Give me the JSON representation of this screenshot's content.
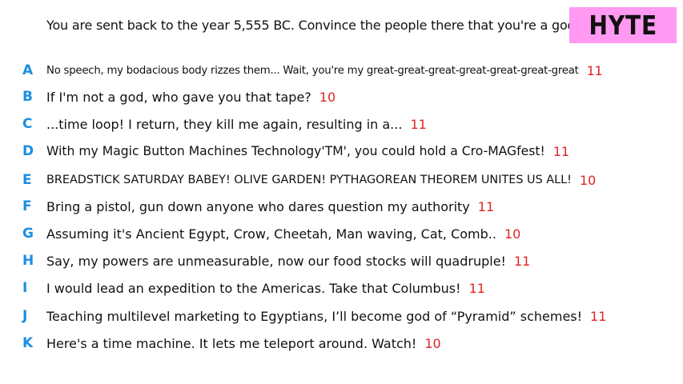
{
  "prompt": "You are sent back to the year 5,555 BC. Convince the people there that you're a god.",
  "brand": "HYTE",
  "colors": {
    "letter": "#1a8fe0",
    "score": "#e32222",
    "badge_bg": "#ff99f2"
  },
  "answers": [
    {
      "letter": "A",
      "text": "No speech, my bodacious body rizzes them... Wait, you're my great-great-great-great-great-great-great",
      "score": "11"
    },
    {
      "letter": "B",
      "text": "If I'm not a god, who gave you that tape?",
      "score": "10"
    },
    {
      "letter": "C",
      "text": "...time loop! I return, they kill me again, resulting in a...",
      "score": "11"
    },
    {
      "letter": "D",
      "text": "With my Magic Button Machines Technology'TM', you could hold a Cro-MAGfest!",
      "score": "11"
    },
    {
      "letter": "E",
      "text": "BREADSTICK SATURDAY BABEY! OLIVE GARDEN! PYTHAGOREAN THEOREM UNITES US ALL!",
      "score": "10"
    },
    {
      "letter": "F",
      "text": "Bring a pistol, gun down anyone who dares question my authority",
      "score": "11"
    },
    {
      "letter": "G",
      "text": "Assuming it's Ancient Egypt, Crow, Cheetah, Man waving, Cat, Comb..",
      "score": "10"
    },
    {
      "letter": "H",
      "text": "Say, my powers are unmeasurable, now our food stocks will quadruple!",
      "score": "11"
    },
    {
      "letter": "I",
      "text": "I would lead an expedition to the Americas. Take that Columbus!",
      "score": "11"
    },
    {
      "letter": "J",
      "text": "Teaching multilevel marketing to Egyptians, I’ll become god of “Pyramid” schemes!",
      "score": "11"
    },
    {
      "letter": "K",
      "text": "Here's a time machine. It lets me teleport around. Watch!",
      "score": "10"
    }
  ]
}
